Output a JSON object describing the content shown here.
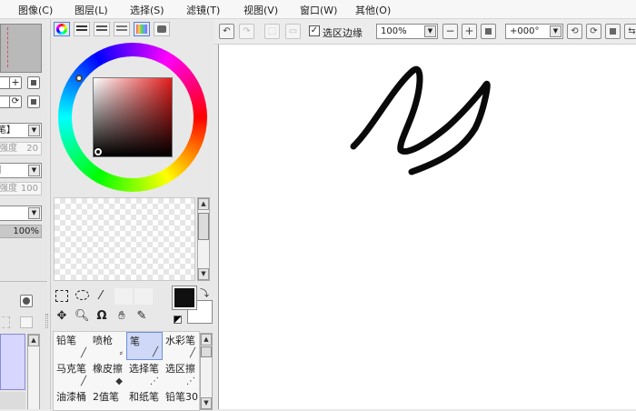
{
  "menu": [
    "图像(C)",
    "图层(L)",
    "选择(S)",
    "滤镜(T)",
    "视图(V)",
    "窗口(W)",
    "其他(O)"
  ],
  "left_panel": {
    "combo1_value": "笔】",
    "slider1_label": "强度",
    "slider1_value": "20",
    "combo2_value": "】",
    "slider2_label": "强度",
    "slider2_value": "100",
    "opacity_value": "100%",
    "opacity_fraction": 1.0
  },
  "color_panel": {
    "tabs": [
      "color-wheel",
      "rgb-sliders",
      "hsv-sliders",
      "color-mixer",
      "swatches",
      "scratchpad"
    ],
    "primary_color": "#101010",
    "secondary_color": "#ffffff"
  },
  "brushes": [
    {
      "label": "铅笔",
      "icon": "pencil"
    },
    {
      "label": "喷枪",
      "icon": "airbrush"
    },
    {
      "label": "笔",
      "icon": "pen",
      "active": true
    },
    {
      "label": "水彩笔",
      "icon": "watercolor"
    },
    {
      "label": "马克笔",
      "icon": "marker"
    },
    {
      "label": "橡皮擦",
      "icon": "eraser"
    },
    {
      "label": "选择笔",
      "icon": "select-pen"
    },
    {
      "label": "选区擦",
      "icon": "select-eraser"
    },
    {
      "label": "油漆桶",
      "icon": "bucket"
    },
    {
      "label": "2值笔",
      "icon": "binary-pen"
    },
    {
      "label": "和纸笔",
      "icon": "washi-pen"
    },
    {
      "label": "铅笔30",
      "icon": "pencil30"
    }
  ],
  "toolbar": {
    "selection_edge_label": "选区边缘",
    "selection_edge_checked": true,
    "zoom_value": "100%",
    "rotation_value": "+000°"
  },
  "canvas": {
    "stroke_color": "#0a0a0a"
  }
}
